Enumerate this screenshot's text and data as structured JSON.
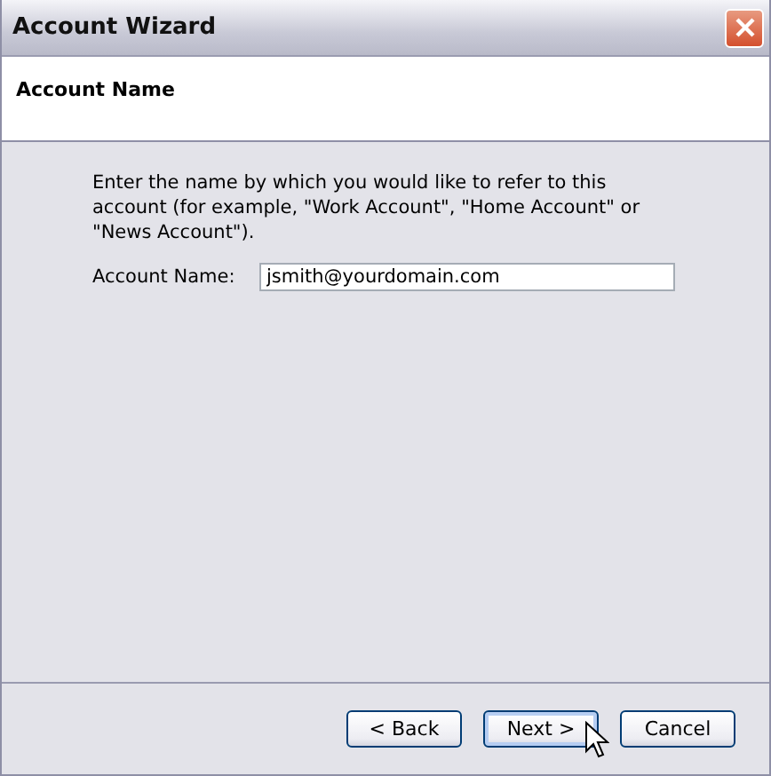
{
  "window": {
    "title": "Account Wizard"
  },
  "header": {
    "title": "Account Name"
  },
  "instructions": "Enter the name by which you would like to refer to this account (for example, \"Work Account\", \"Home Account\" or \"News Account\").",
  "field": {
    "label": "Account Name:",
    "value": "jsmith@yourdomain.com"
  },
  "buttons": [
    {
      "label": "< Back",
      "default": false
    },
    {
      "label": "Next >",
      "default": true
    },
    {
      "label": "Cancel",
      "default": false
    }
  ]
}
